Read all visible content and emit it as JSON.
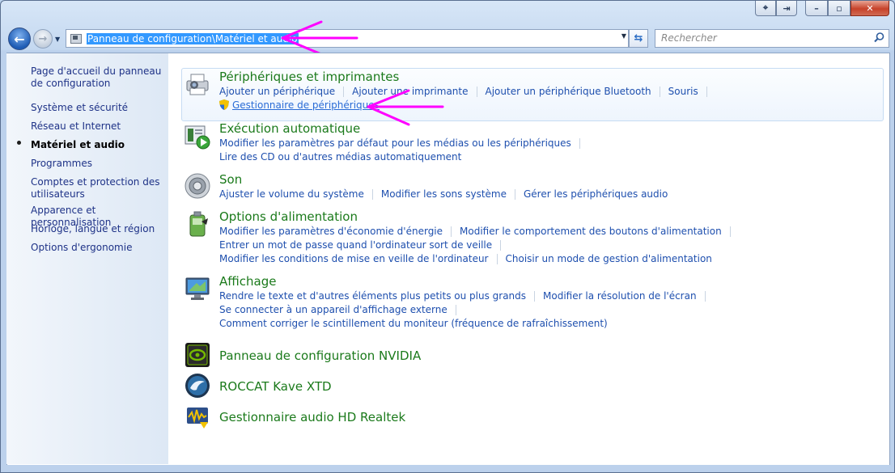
{
  "address": {
    "path": "Panneau de configuration\\Matériel et audio"
  },
  "search": {
    "placeholder": "Rechercher"
  },
  "sidebar": {
    "items": [
      {
        "label": "Page d'accueil du panneau de configuration"
      },
      {
        "label": "Système et sécurité"
      },
      {
        "label": "Réseau et Internet"
      },
      {
        "label": "Matériel et audio",
        "active": true
      },
      {
        "label": "Programmes"
      },
      {
        "label": "Comptes et protection des utilisateurs"
      },
      {
        "label": "Apparence et personnalisation"
      },
      {
        "label": "Horloge, langue et région"
      },
      {
        "label": "Options d'ergonomie"
      }
    ]
  },
  "categories": [
    {
      "title": "Périphériques et imprimantes",
      "icon": "printer-icon",
      "rows": [
        [
          "Ajouter un périphérique",
          "Ajouter une imprimante",
          "Ajouter un périphérique Bluetooth",
          "Souris"
        ],
        [
          "Gestionnaire de périphériques"
        ]
      ]
    },
    {
      "title": "Exécution automatique",
      "icon": "autoplay-icon",
      "rows": [
        [
          "Modifier les paramètres par défaut pour les médias ou les périphériques"
        ],
        [
          "Lire des CD ou d'autres médias automatiquement"
        ]
      ]
    },
    {
      "title": "Son",
      "icon": "speaker-icon",
      "rows": [
        [
          "Ajuster le volume du système",
          "Modifier les sons système",
          "Gérer les périphériques audio"
        ]
      ]
    },
    {
      "title": "Options d'alimentation",
      "icon": "battery-icon",
      "rows": [
        [
          "Modifier les paramètres d'économie d'énergie",
          "Modifier le comportement des boutons d'alimentation"
        ],
        [
          "Entrer un mot de passe quand l'ordinateur sort de veille"
        ],
        [
          "Modifier les conditions de mise en veille de l'ordinateur",
          "Choisir un mode de gestion d'alimentation"
        ]
      ]
    },
    {
      "title": "Affichage",
      "icon": "monitor-icon",
      "rows": [
        [
          "Rendre le texte et d'autres éléments plus petits ou plus grands",
          "Modifier la résolution de l'écran"
        ],
        [
          "Se connecter à un appareil d'affichage externe"
        ],
        [
          "Comment corriger le scintillement du moniteur (fréquence de rafraîchissement)"
        ]
      ]
    },
    {
      "title": "Panneau de configuration NVIDIA",
      "icon": "nvidia-icon",
      "rows": []
    },
    {
      "title": "ROCCAT Kave XTD",
      "icon": "roccat-icon",
      "rows": []
    },
    {
      "title": "Gestionnaire audio HD Realtek",
      "icon": "realtek-audio-icon",
      "rows": []
    }
  ],
  "colors": {
    "annotation_arrow": "#ff00ff",
    "category_title": "#1b7a1b",
    "link": "#1e4fae"
  }
}
